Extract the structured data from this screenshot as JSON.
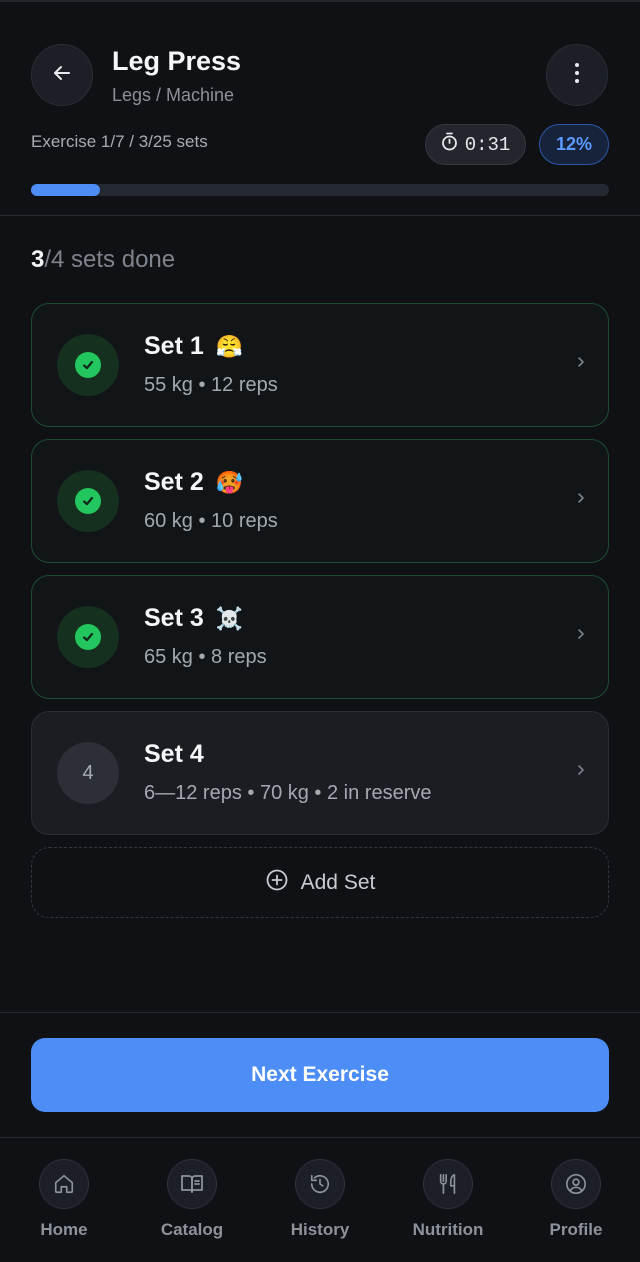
{
  "header": {
    "title": "Leg Press",
    "subtitle": "Legs / Machine",
    "progress_text": "Exercise 1/7 / 3/25 sets",
    "timer": "0:31",
    "percent_label": "12%",
    "progress_fraction": 0.12
  },
  "sets_summary": {
    "done": "3",
    "rest": "/4 sets done"
  },
  "sets": [
    {
      "title": "Set 1",
      "emoji": "😤",
      "detail": "55 kg • 12 reps",
      "status": "done"
    },
    {
      "title": "Set 2",
      "emoji": "🥵",
      "detail": "60 kg • 10 reps",
      "status": "done"
    },
    {
      "title": "Set 3",
      "emoji": "☠️",
      "detail": "65 kg • 8 reps",
      "status": "done"
    },
    {
      "title": "Set 4",
      "emoji": "",
      "number": "4",
      "detail": "6—12 reps • 70 kg • 2 in reserve",
      "status": "pending"
    }
  ],
  "add_set_label": "Add Set",
  "next_button_label": "Next Exercise",
  "nav": [
    {
      "label": "Home",
      "icon": "home-icon"
    },
    {
      "label": "Catalog",
      "icon": "book-icon"
    },
    {
      "label": "History",
      "icon": "history-icon"
    },
    {
      "label": "Nutrition",
      "icon": "utensils-icon"
    },
    {
      "label": "Profile",
      "icon": "user-circle-icon"
    }
  ],
  "colors": {
    "accent": "#4d8df6",
    "success": "#22c55e",
    "background": "#0f1115"
  }
}
